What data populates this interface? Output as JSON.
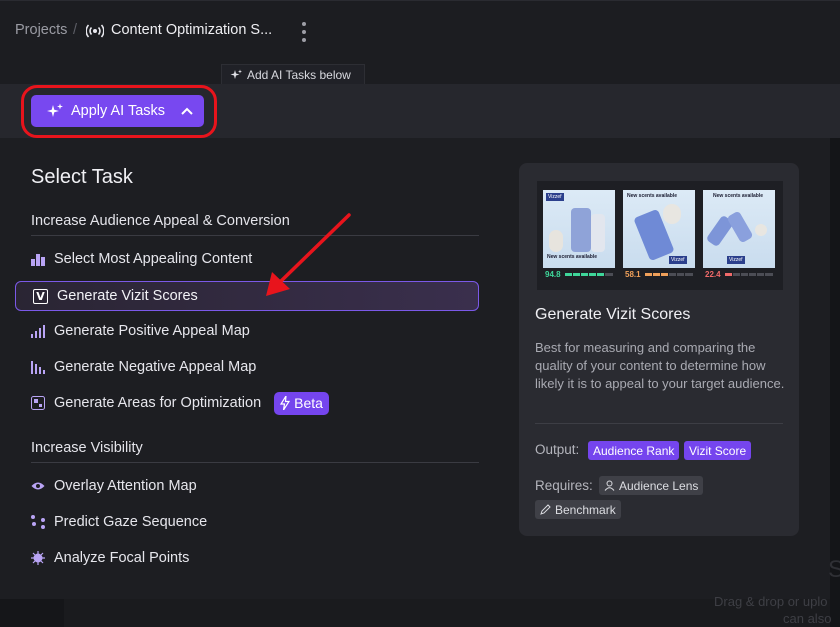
{
  "breadcrumb": {
    "projects": "Projects",
    "separator": "/",
    "project_icon": "broadcast-icon",
    "project_title": "Content Optimization S..."
  },
  "toolbar": {
    "hint": "Add AI Tasks below",
    "apply_label": "Apply AI Tasks",
    "apply_color": "#7848f0",
    "highlight_ring_color": "#e8141c"
  },
  "panel": {
    "title": "Select Task",
    "sections": [
      {
        "heading": "Increase Audience Appeal & Conversion",
        "tasks": [
          {
            "label": "Select Most Appealing Content",
            "icon": "podium-icon"
          },
          {
            "label": "Generate Vizit Scores",
            "icon": "vizit-v-icon",
            "selected": true
          },
          {
            "label": "Generate Positive Appeal Map",
            "icon": "bar-chart-up-icon"
          },
          {
            "label": "Generate Negative Appeal Map",
            "icon": "bar-chart-down-icon"
          },
          {
            "label": "Generate Areas for Optimization",
            "icon": "optimization-icon",
            "badge": "Beta"
          }
        ]
      },
      {
        "heading": "Increase Visibility",
        "tasks": [
          {
            "label": "Overlay Attention Map",
            "icon": "eye-icon"
          },
          {
            "label": "Predict Gaze Sequence",
            "icon": "gaze-sequence-icon"
          },
          {
            "label": "Analyze Focal Points",
            "icon": "focal-point-icon"
          }
        ]
      }
    ]
  },
  "detail": {
    "title": "Generate Vizit Scores",
    "description": "Best for measuring and comparing the quality of your content to determine how likely it is to appeal to your target audience.",
    "output_label": "Output:",
    "outputs": [
      "Audience Rank",
      "Vizit Score"
    ],
    "requires_label": "Requires:",
    "requires": [
      {
        "label": "Audience Lens",
        "icon": "person-icon"
      },
      {
        "label": "Benchmark",
        "icon": "pencil-icon"
      }
    ],
    "preview": {
      "thumbnails": [
        {
          "caption": "New scents available",
          "brand": "Vizzef",
          "score": "94.8",
          "score_color": "#3fd69a"
        },
        {
          "caption": "New scents available",
          "brand": "Vizzef",
          "score": "58.1",
          "score_color": "#f0a05a"
        },
        {
          "caption": "New scents available",
          "brand": "Vizzef",
          "score": "22.4",
          "score_color": "#f06a6a"
        }
      ]
    }
  },
  "background": {
    "ghost_line1": "Drag & drop or uplo",
    "ghost_line2": "can also"
  }
}
